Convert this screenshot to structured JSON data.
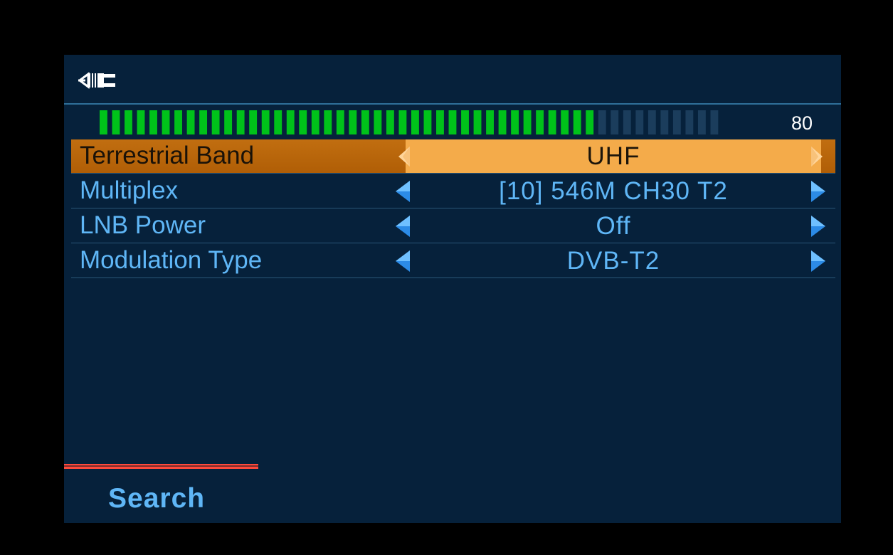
{
  "header": {
    "icon": "antenna-cable-icon"
  },
  "signal": {
    "value": "80",
    "level_fraction": 0.8,
    "segments_total": 50,
    "segments_lit": 40,
    "lit_color": "#00c21a",
    "unlit_color": "#1b3d5c"
  },
  "menu": {
    "items": [
      {
        "label": "Terrestrial Band",
        "value": "UHF",
        "selected": true
      },
      {
        "label": "Multiplex",
        "value": "[10] 546M CH30 T2",
        "selected": false
      },
      {
        "label": "LNB Power",
        "value": "Off",
        "selected": false
      },
      {
        "label": "Modulation Type",
        "value": "DVB-T2",
        "selected": false
      }
    ]
  },
  "footer": {
    "search_label": "Search"
  },
  "colors": {
    "background": "#06213b",
    "text": "#5fb6f6",
    "highlight": "#f4ab4a",
    "highlight_dark": "#b65f06",
    "accent_red": "#ff4a3b"
  }
}
